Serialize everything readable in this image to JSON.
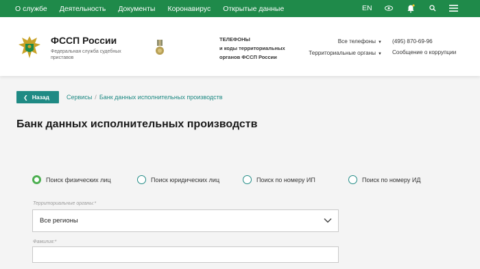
{
  "topnav": {
    "items": [
      "О службе",
      "Деятельность",
      "Документы",
      "Коронавирус",
      "Открытые данные"
    ],
    "lang": "EN",
    "icons": [
      "eye-icon",
      "bell-icon",
      "search-icon",
      "menu-icon"
    ]
  },
  "header": {
    "brand_title": "ФССП России",
    "brand_sub": "Федеральная служба судебных приставов",
    "phones_line1": "ТЕЛЕФОНЫ",
    "phones_line2": "и коды территориальных",
    "phones_line3": "органов ФССП России",
    "all_phones": "Все телефоны",
    "territorial": "Территориальные органы",
    "phone_number": "(495) 870-69-96",
    "corruption": "Сообщение о коррупции"
  },
  "nav": {
    "back": "Назад",
    "breadcrumb_1": "Сервисы",
    "breadcrumb_sep": "/",
    "breadcrumb_2": "Банк данных исполнительных производств"
  },
  "page_title": "Банк данных исполнительных производств",
  "search_modes": [
    {
      "label": "Поиск физических лиц",
      "checked": true
    },
    {
      "label": "Поиск юридических лиц",
      "checked": false
    },
    {
      "label": "Поиск по номеру ИП",
      "checked": false
    },
    {
      "label": "Поиск по номеру ИД",
      "checked": false
    }
  ],
  "form": {
    "territorial_label": "Территориальные органы:*",
    "territorial_value": "Все регионы",
    "surname_label": "Фамилия:*",
    "surname_value": ""
  },
  "colors": {
    "topnav_bg": "#1f8a4a",
    "accent": "#1f8a84",
    "radio_checked": "#4caf50"
  }
}
